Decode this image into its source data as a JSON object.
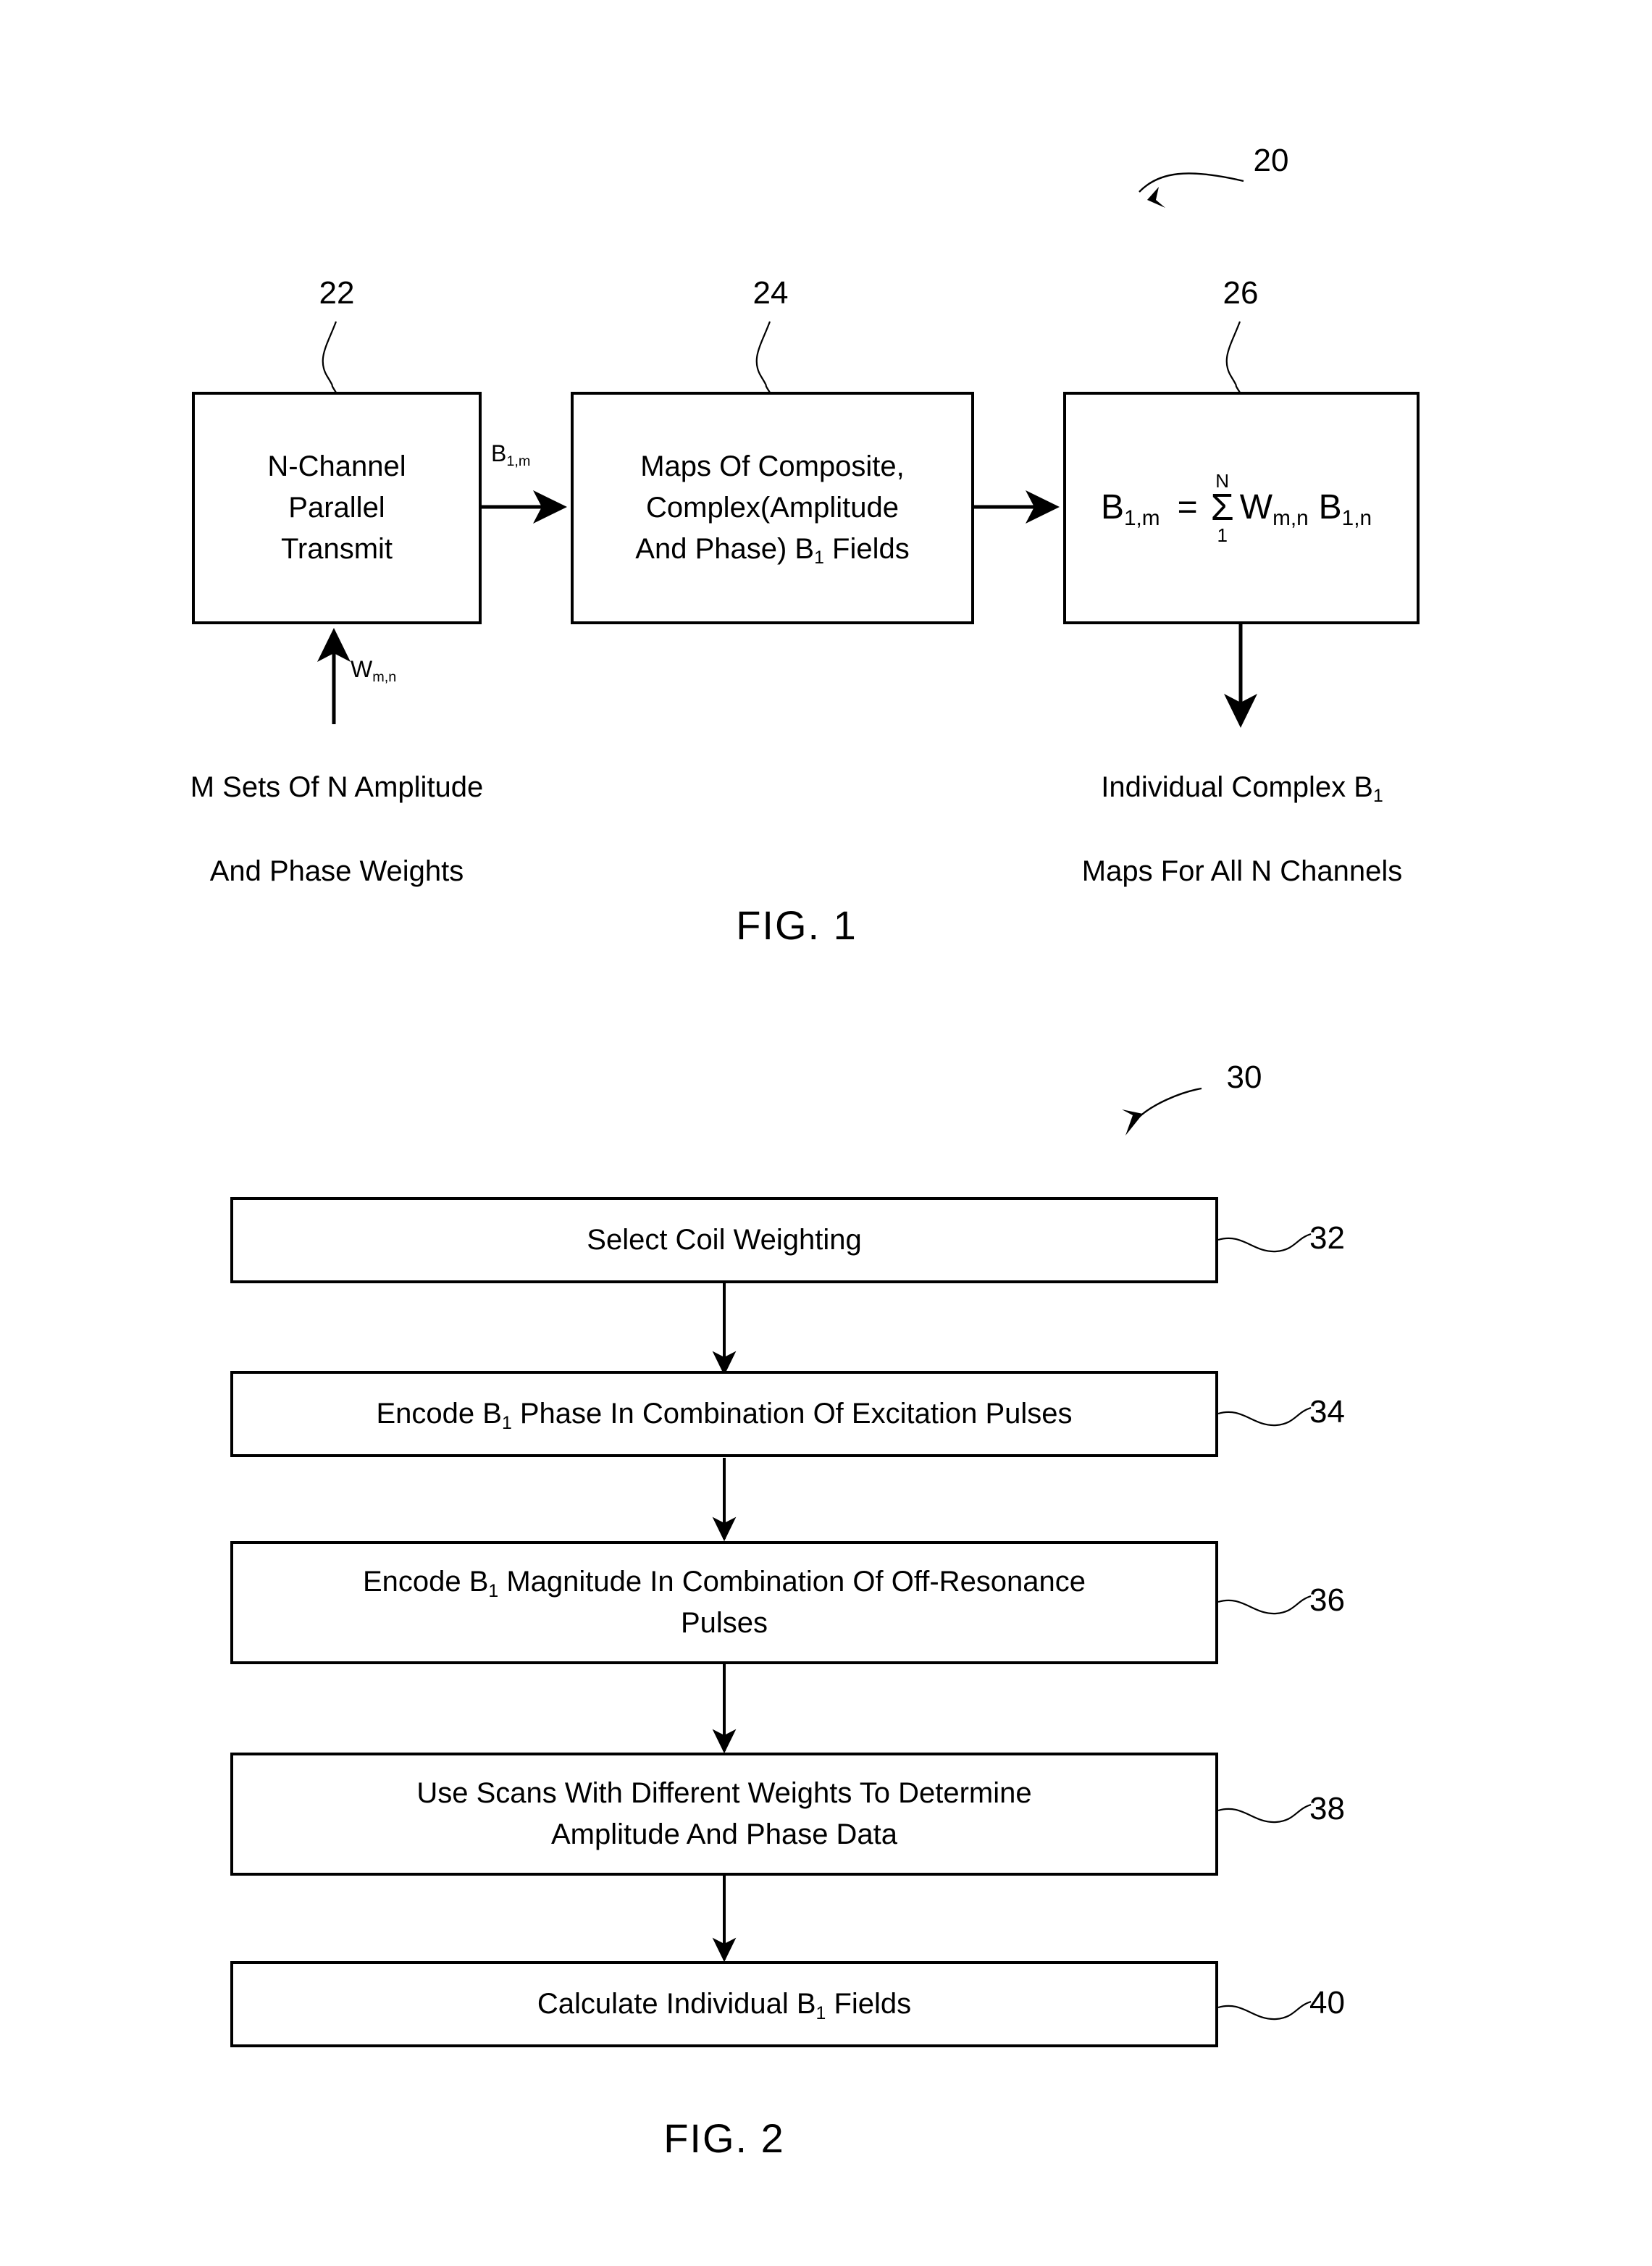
{
  "figures": [
    {
      "id": "fig1",
      "caption": "FIG. 1",
      "system_ref": "20",
      "boxes": [
        {
          "ref": "22",
          "text": "N-Channel\nParallel\nTransmit"
        },
        {
          "ref": "24",
          "text": "Maps Of Composite,\nComplex(Amplitude\nAnd Phase) B₁ Fields"
        },
        {
          "ref": "26",
          "text": "B₁,ₘ = ∑₁ᴺ Wₘ,ₙ B₁,ₙ"
        }
      ],
      "box1_label": "N-Channel Parallel Transmit",
      "box2_line1": "Maps Of Composite,",
      "box2_line2": "Complex(Amplitude",
      "box2_line3_a": "And Phase) B",
      "box2_line3_sub": "1",
      "box2_line3_b": " Fields",
      "formula": {
        "lhs_base": "B",
        "lhs_sub": "1,m",
        "equals": "=",
        "sum_upper": "N",
        "sum_symbol": "Σ",
        "sum_lower": "1",
        "w_base": "W",
        "w_sub": "m,n",
        "b_base": "B",
        "b_sub": "1,n"
      },
      "arrow_label_base": "B",
      "arrow_label_sub": "1,m",
      "weight_label_base": "W",
      "weight_label_sub": "m,n",
      "input_caption_line1": "M Sets Of N Amplitude",
      "input_caption_line2": "And Phase Weights",
      "output_caption_line1_a": "Individual Complex B",
      "output_caption_line1_sub": "1",
      "output_caption_line2": "Maps For All N Channels"
    },
    {
      "id": "fig2",
      "caption": "FIG. 2",
      "system_ref": "30",
      "steps": [
        {
          "ref": "32",
          "text": "Select Coil Weighting",
          "has_sub": false
        },
        {
          "ref": "34",
          "text_a": "Encode B",
          "sub": "1",
          "text_b": " Phase In Combination Of Excitation Pulses",
          "has_sub": true
        },
        {
          "ref": "36",
          "text_a": "Encode B",
          "sub": "1",
          "text_b": " Magnitude In Combination Of Off-Resonance",
          "text_line2": "Pulses",
          "has_sub": true
        },
        {
          "ref": "38",
          "text_line1": "Use Scans With Different Weights To Determine",
          "text_line2": "Amplitude And Phase Data",
          "has_sub": false
        },
        {
          "ref": "40",
          "text_a": "Calculate Individual B",
          "sub": "1",
          "text_b": " Fields",
          "has_sub": true
        }
      ]
    }
  ],
  "fig1": {
    "caption": "FIG. 1",
    "ref_system": "20",
    "ref_box1": "22",
    "ref_box2": "24",
    "ref_box3": "26",
    "box1_l1": "N-Channel",
    "box1_l2": "Parallel",
    "box1_l3": "Transmit",
    "box2_l1": "Maps Of Composite,",
    "box2_l2": "Complex(Amplitude",
    "box2_l3a": "And Phase) B",
    "box2_l3sub": "1",
    "box2_l3b": " Fields",
    "f_lhs": "B",
    "f_lhs_sub": "1,m",
    "f_eq": "=",
    "f_sum_top": "N",
    "f_sum": "Σ",
    "f_sum_bot": "1",
    "f_w": "W",
    "f_w_sub": "m,n",
    "f_b": "B",
    "f_b_sub": "1,n",
    "arrow_lbl": "B",
    "arrow_lbl_sub": "1,m",
    "weight_lbl": "W",
    "weight_lbl_sub": "m,n",
    "in_l1": "M Sets Of N Amplitude",
    "in_l2": "And Phase Weights",
    "out_l1a": "Individual Complex B",
    "out_l1sub": "1",
    "out_l2": "Maps For All N Channels"
  },
  "fig2": {
    "caption": "FIG. 2",
    "ref_system": "30",
    "ref_32": "32",
    "ref_34": "34",
    "ref_36": "36",
    "ref_38": "38",
    "ref_40": "40",
    "s32": "Select Coil Weighting",
    "s34a": "Encode B",
    "s34sub": "1",
    "s34b": " Phase In Combination Of Excitation Pulses",
    "s36a": "Encode B",
    "s36sub": "1",
    "s36b": " Magnitude In Combination Of Off-Resonance",
    "s36_l2": "Pulses",
    "s38_l1": "Use Scans With Different Weights To Determine",
    "s38_l2": "Amplitude And Phase Data",
    "s40a": "Calculate Individual B",
    "s40sub": "1",
    "s40b": " Fields"
  },
  "colors": {
    "ink": "#000000",
    "paper": "#ffffff"
  }
}
